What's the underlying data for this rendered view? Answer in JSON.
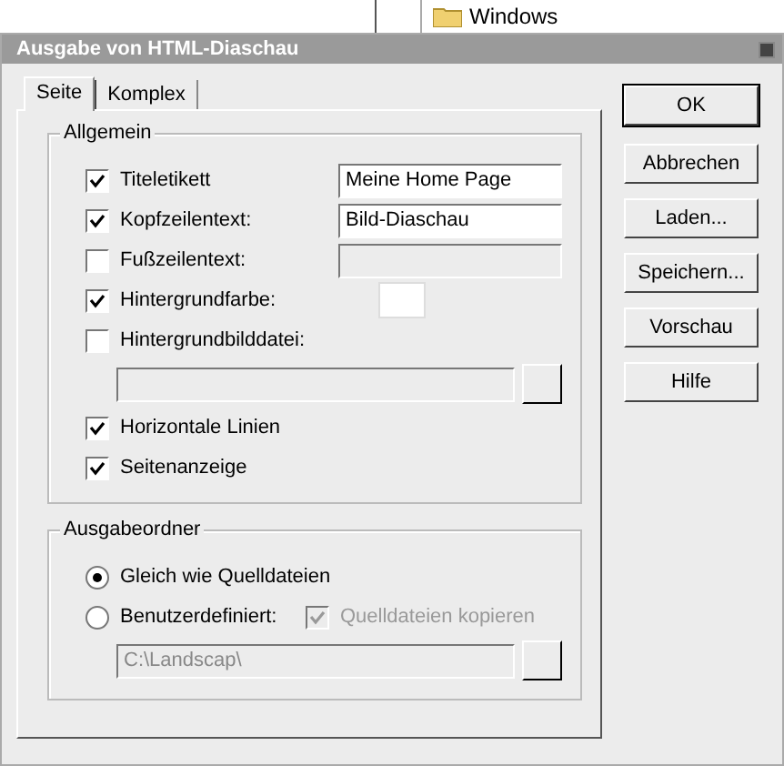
{
  "background": {
    "tree_item": "Windows"
  },
  "window": {
    "title": "Ausgabe von HTML-Diaschau"
  },
  "tabs": [
    {
      "label": "Seite",
      "selected": true
    },
    {
      "label": "Komplex",
      "selected": false
    }
  ],
  "general": {
    "title": "Allgemein",
    "rows": [
      {
        "kind": "field",
        "label": "Titeletikett",
        "checked": true,
        "value": "Meine Home Page"
      },
      {
        "kind": "field",
        "label": "Kopfzeilentext:",
        "checked": true,
        "value": "Bild-Diaschau"
      },
      {
        "kind": "field",
        "label": "Fußzeilentext:",
        "checked": false
      },
      {
        "kind": "color",
        "label": "Hintergrundfarbe:",
        "checked": true
      },
      {
        "kind": "file",
        "label": "Hintergrundbilddatei:",
        "checked": false
      },
      {
        "kind": "check",
        "label": "Horizontale Linien",
        "checked": true
      },
      {
        "kind": "check",
        "label": "Seitenanzeige",
        "checked": true
      }
    ]
  },
  "output": {
    "title": "Ausgabeordner",
    "options": [
      {
        "label": "Gleich wie Quelldateien",
        "selected": true
      },
      {
        "label": "Benutzerdefiniert:",
        "selected": false
      }
    ],
    "copy": {
      "label": "Quelldateien kopieren",
      "checked": true,
      "disabled": true
    },
    "path": {
      "value": "C:\\Landscap\\",
      "disabled": true
    }
  },
  "buttons": [
    {
      "label": "OK",
      "default": true
    },
    {
      "label": "Abbrechen",
      "default": false
    },
    {
      "label": "Laden...",
      "default": false
    },
    {
      "label": "Speichern...",
      "default": false
    },
    {
      "label": "Vorschau",
      "default": false
    },
    {
      "label": "Hilfe",
      "default": false
    }
  ]
}
